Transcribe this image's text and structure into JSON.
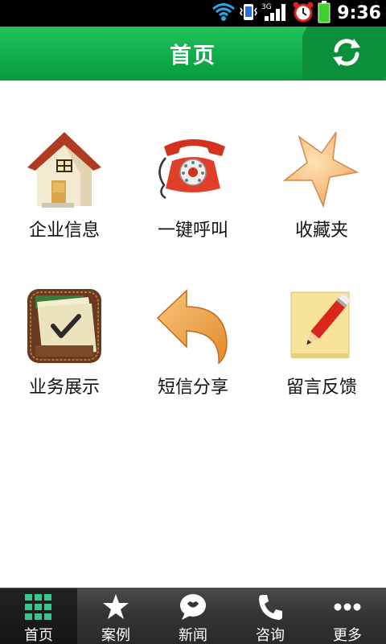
{
  "status_bar": {
    "time": "9:36",
    "network": "3G",
    "icons": [
      "wifi-icon",
      "vibrate-icon",
      "signal-icon",
      "alarm-icon",
      "battery-icon"
    ]
  },
  "header": {
    "title": "首页",
    "refresh_icon": "refresh-icon",
    "color": "#0fae4b"
  },
  "grid": {
    "items": [
      {
        "label": "企业信息",
        "icon": "house-icon"
      },
      {
        "label": "一键呼叫",
        "icon": "telephone-icon"
      },
      {
        "label": "收藏夹",
        "icon": "star-icon"
      },
      {
        "label": "业务展示",
        "icon": "checklist-icon"
      },
      {
        "label": "短信分享",
        "icon": "share-arrow-icon"
      },
      {
        "label": "留言反馈",
        "icon": "note-pencil-icon"
      }
    ]
  },
  "tabbar": {
    "tabs": [
      {
        "label": "首页",
        "icon": "grid-icon",
        "active": true
      },
      {
        "label": "案例",
        "icon": "star-icon"
      },
      {
        "label": "新闻",
        "icon": "chat-bubble-icon"
      },
      {
        "label": "咨询",
        "icon": "phone-handset-icon"
      },
      {
        "label": "更多",
        "icon": "more-dots-icon"
      }
    ]
  }
}
